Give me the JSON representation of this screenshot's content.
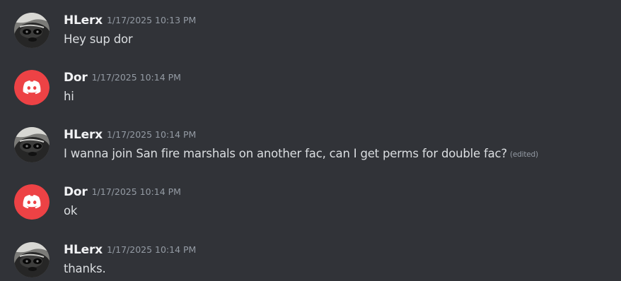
{
  "messages": [
    {
      "author": "HLerx",
      "timestamp": "1/17/2025 10:13 PM",
      "text": "Hey sup dor",
      "avatar": "raccoon-avatar"
    },
    {
      "author": "Dor",
      "timestamp": "1/17/2025 10:14 PM",
      "text": "hi",
      "avatar": "discord-logo-avatar"
    },
    {
      "author": "HLerx",
      "timestamp": "1/17/2025 10:14 PM",
      "text": "I wanna join San fire marshals on another fac, can I get perms for double fac?",
      "edited": "(edited)",
      "avatar": "raccoon-avatar"
    },
    {
      "author": "Dor",
      "timestamp": "1/17/2025 10:14 PM",
      "text": "ok",
      "avatar": "discord-logo-avatar"
    },
    {
      "author": "HLerx",
      "timestamp": "1/17/2025 10:14 PM",
      "text": "thanks.",
      "avatar": "raccoon-avatar"
    }
  ],
  "colors": {
    "background": "#313338",
    "username": "#f2f3f5",
    "message_text": "#dbdee1",
    "timestamp": "#949ba4",
    "discord_red": "#ed4245"
  }
}
